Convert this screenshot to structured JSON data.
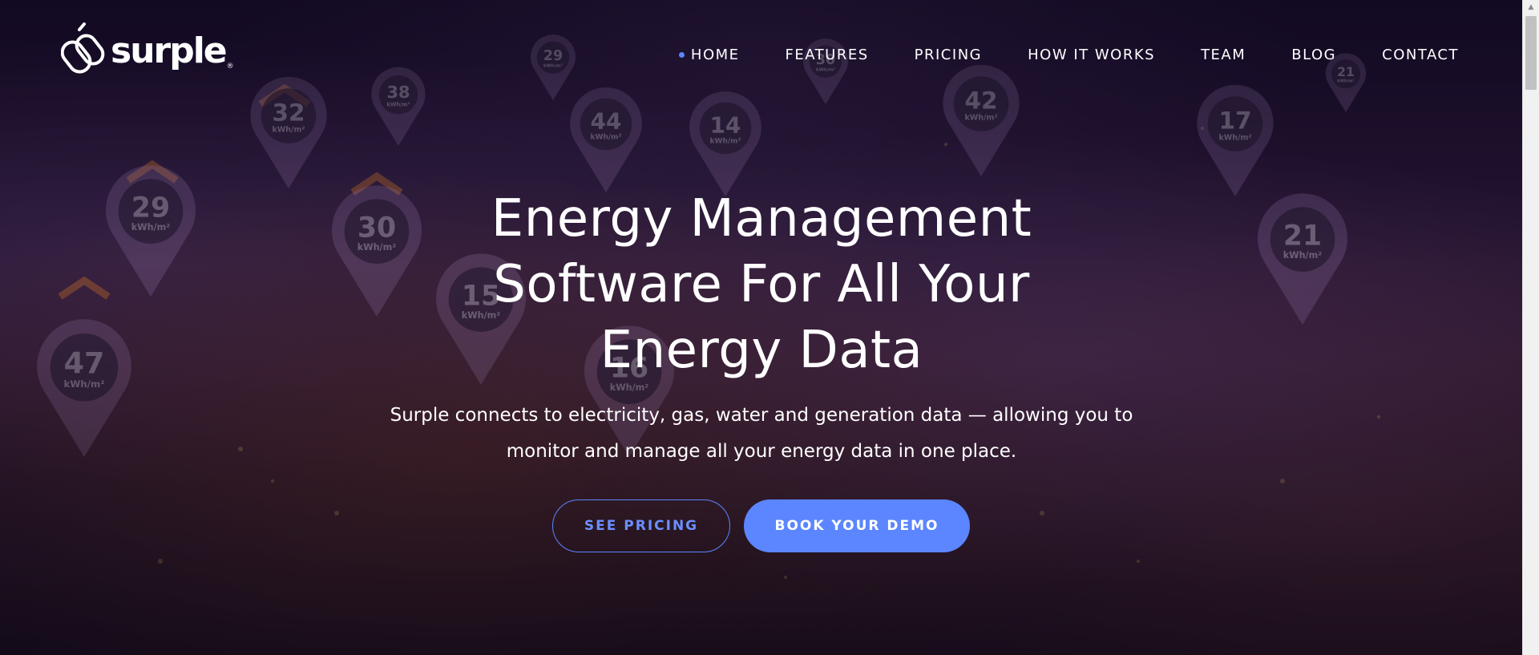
{
  "brand": {
    "name": "surple",
    "tm": "®"
  },
  "nav": {
    "items": [
      {
        "label": "HOME",
        "active": true
      },
      {
        "label": "FEATURES",
        "active": false
      },
      {
        "label": "PRICING",
        "active": false
      },
      {
        "label": "HOW IT WORKS",
        "active": false
      },
      {
        "label": "TEAM",
        "active": false
      },
      {
        "label": "BLOG",
        "active": false
      },
      {
        "label": "CONTACT",
        "active": false
      }
    ]
  },
  "hero": {
    "title_lines": [
      "Energy Management",
      "Software For All Your",
      "Energy Data"
    ],
    "subtitle_lines": [
      "Surple connects to electricity, gas, water and generation data — allowing you to",
      "monitor and manage all your energy data in one place."
    ],
    "buttons": {
      "pricing_label": "SEE PRICING",
      "demo_label": "BOOK YOUR DEMO"
    }
  },
  "background": {
    "pin_values": [
      "29",
      "30",
      "47",
      "15",
      "16",
      "32",
      "38",
      "44",
      "14",
      "42",
      "17",
      "21",
      "30",
      "21",
      "29"
    ],
    "pin_unit": "kWh/m²"
  },
  "colors": {
    "accent": "#5b86ff",
    "text": "#ffffff",
    "background": "#1a0f2e"
  },
  "icons": {
    "logo": "surple-chain-logo-icon",
    "active_indicator": "dot-icon",
    "scroll_up": "triangle-up-icon"
  }
}
